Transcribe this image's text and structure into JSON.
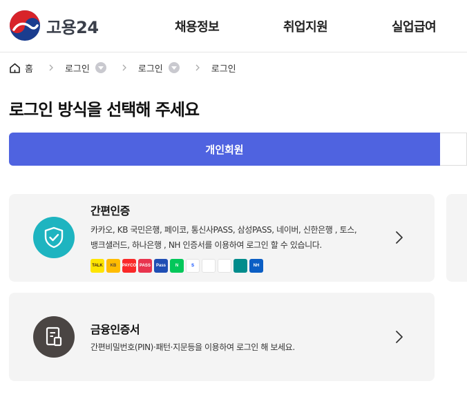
{
  "header": {
    "logo_text": "고용24",
    "nav": [
      "채용정보",
      "취업지원",
      "실업급여"
    ]
  },
  "breadcrumb": {
    "home": "홈",
    "items": [
      "로그인",
      "로그인",
      "로그인"
    ]
  },
  "page": {
    "title": "로그인 방식을 선택해 주세요"
  },
  "tabs": {
    "personal": "개인회원"
  },
  "cards": {
    "simple": {
      "title": "간편인증",
      "desc_line1": "카카오, KB 국민은행, 페이코, 통신사PASS, 삼성PASS, 네이버, 신한은행 , 토스,",
      "desc_line2": "뱅크샐러드, 하나은행 , NH 인증서를 이용하여 로그인 할 수 있습니다.",
      "providers": [
        {
          "name": "kakao-icon",
          "label": "TALK",
          "bg": "#fee500",
          "fg": "#3a1d1d"
        },
        {
          "name": "kb-icon",
          "label": "KB",
          "bg": "#ffbc00",
          "fg": "#5b4a36"
        },
        {
          "name": "payco-icon",
          "label": "PAYCO",
          "bg": "#fa2828",
          "fg": "#ffffff"
        },
        {
          "name": "pass-icon",
          "label": "PASS",
          "bg": "#e8344e",
          "fg": "#ffffff"
        },
        {
          "name": "samsung-pass-icon",
          "label": "Pass",
          "bg": "#1f4eb4",
          "fg": "#ffffff"
        },
        {
          "name": "naver-icon",
          "label": "N",
          "bg": "#03c75a",
          "fg": "#ffffff"
        },
        {
          "name": "shinhan-icon",
          "label": "S",
          "bg": "#ffffff",
          "fg": "#0046ff"
        },
        {
          "name": "toss-icon",
          "label": "",
          "bg": "#ffffff",
          "fg": "#0064ff"
        },
        {
          "name": "banksalad-icon",
          "label": "",
          "bg": "#ffffff",
          "fg": "#00c473"
        },
        {
          "name": "hana-icon",
          "label": "",
          "bg": "#008c8c",
          "fg": "#ffffff"
        },
        {
          "name": "nh-icon",
          "label": "NH",
          "bg": "#0b5ec4",
          "fg": "#ffffff"
        }
      ]
    },
    "cert": {
      "title": "금융인증서",
      "desc": "간편비밀번호(PIN)·패턴·지문등을 이용하여 로그인 해 보세요."
    }
  },
  "colors": {
    "accent": "#4f63e0",
    "simple_icon_bg": "#1eb4c0",
    "cert_icon_bg": "#4a4543",
    "card_bg": "#f4f4f4"
  }
}
